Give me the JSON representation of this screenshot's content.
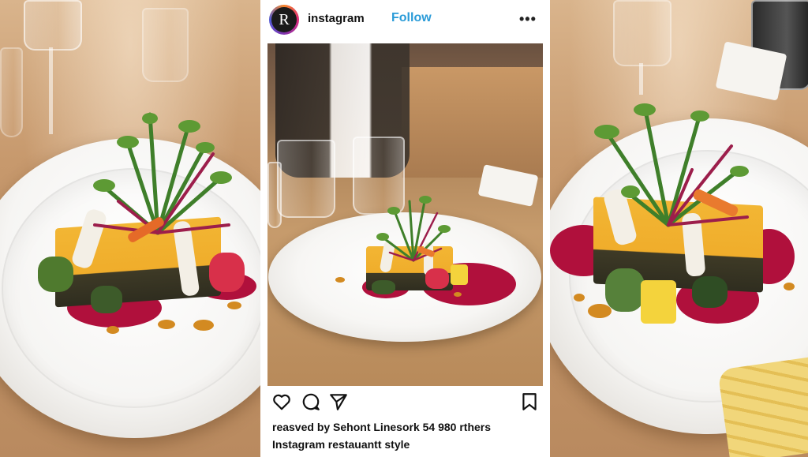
{
  "post": {
    "username": "instagram",
    "avatar_letter": "R",
    "follow_label": "Follow",
    "more_label": "•••",
    "likes_text": "reasved by Sehont Linesork 54 980 rthers",
    "caption_text": "Instagram restauantt style"
  },
  "icons": {
    "avatar": "profile-avatar",
    "more": "more-options-icon",
    "like": "heart-icon",
    "comment": "comment-icon",
    "share": "send-icon",
    "save": "bookmark-icon"
  },
  "colors": {
    "follow": "#2a9bd8",
    "text": "#111111",
    "sauce": "#b0103c",
    "cake": "#f2b634"
  }
}
